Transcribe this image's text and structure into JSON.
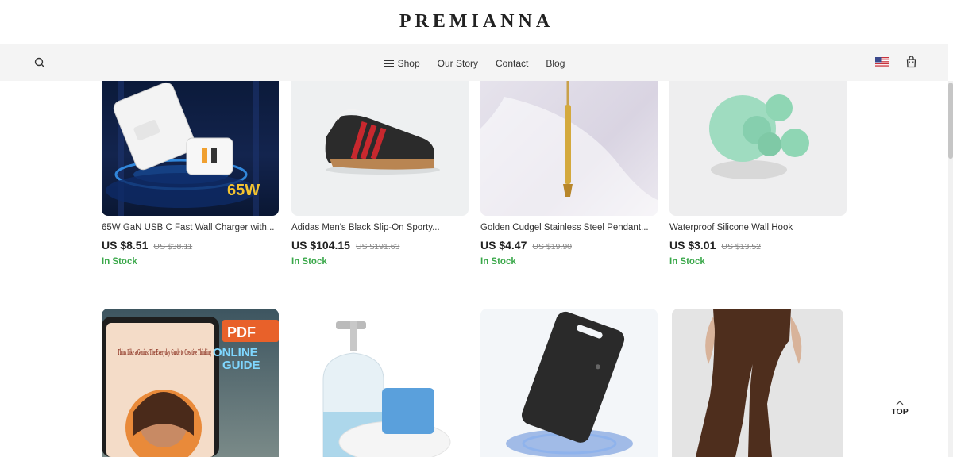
{
  "brand": "PREMIANNA",
  "nav": {
    "links": [
      {
        "label": "Shop"
      },
      {
        "label": "Our Story"
      },
      {
        "label": "Contact"
      },
      {
        "label": "Blog"
      }
    ]
  },
  "products_row1": [
    {
      "name": "65W GaN USB C Fast Wall Charger with...",
      "price": "US $8.51",
      "old_price": "US $38.11",
      "stock": "In Stock",
      "image_text": "65W"
    },
    {
      "name": "Adidas Men's Black Slip-On Sporty...",
      "price": "US $104.15",
      "old_price": "US $191.63",
      "stock": "In Stock"
    },
    {
      "name": "Golden Cudgel Stainless Steel Pendant...",
      "price": "US $4.47",
      "old_price": "US $19.90",
      "stock": "In Stock"
    },
    {
      "name": "Waterproof Silicone Wall Hook",
      "price": "US $3.01",
      "old_price": "US $13.52",
      "stock": "In Stock"
    }
  ],
  "products_row2": [
    {
      "image_text": [
        "PDF",
        "ONLINE",
        "GUIDE",
        "Think Like a Genius: The Everyday Guide to Creative Thinking"
      ]
    },
    {},
    {},
    {}
  ],
  "top_button": "TOP"
}
